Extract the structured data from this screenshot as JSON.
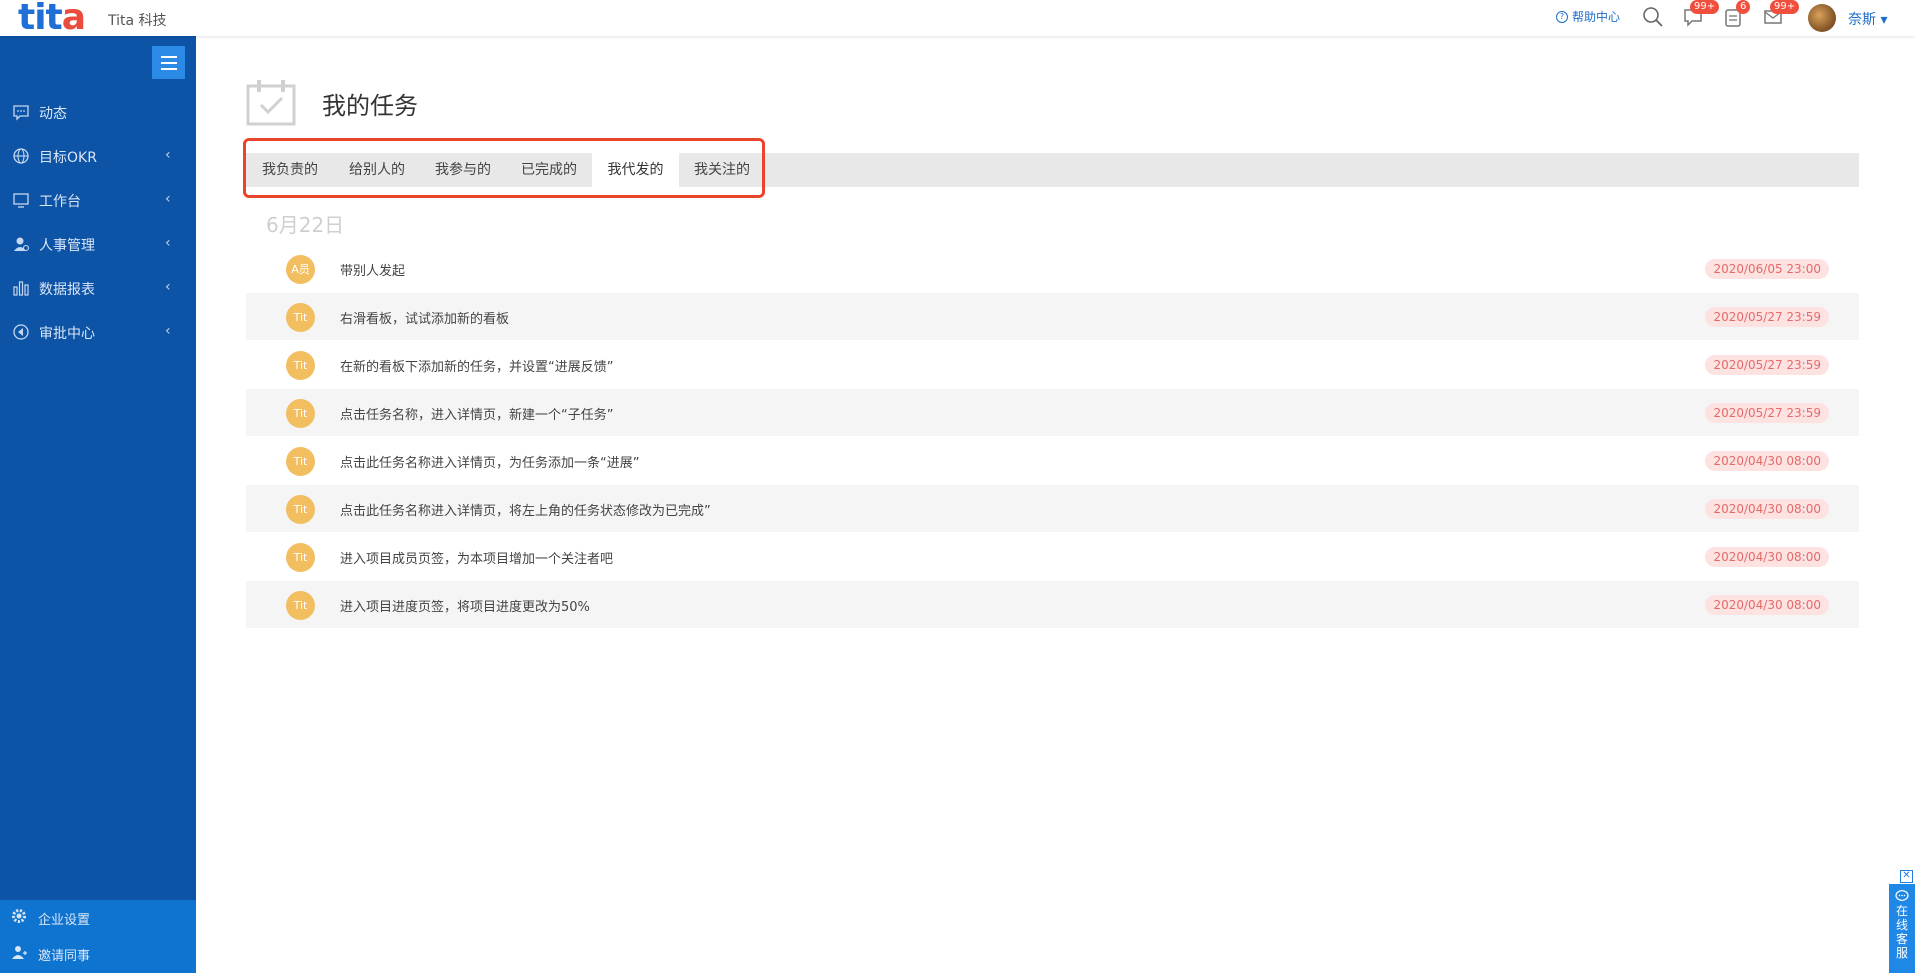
{
  "topbar": {
    "logo_part1": "tit",
    "logo_part2": "a",
    "company": "Tita 科技",
    "help_label": "帮助中心",
    "badges": {
      "messages": "99+",
      "tasks": "6",
      "mail": "99+"
    },
    "user_name": "奈斯 ▾"
  },
  "sidebar": {
    "items": [
      {
        "label": "动态",
        "icon": "comment-icon",
        "chevron": ""
      },
      {
        "label": "目标OKR",
        "icon": "globe-icon",
        "chevron": "‹"
      },
      {
        "label": "工作台",
        "icon": "monitor-icon",
        "chevron": "‹"
      },
      {
        "label": "人事管理",
        "icon": "person-icon",
        "chevron": "‹"
      },
      {
        "label": "数据报表",
        "icon": "bar-chart-icon",
        "chevron": "‹"
      },
      {
        "label": "审批中心",
        "icon": "approval-icon",
        "chevron": "‹"
      }
    ],
    "bottom": [
      {
        "label": "企业设置",
        "icon": "gear-icon"
      },
      {
        "label": "邀请同事",
        "icon": "add-user-icon"
      }
    ]
  },
  "main": {
    "title": "我的任务",
    "tabs": [
      "我负责的",
      "给别人的",
      "我参与的",
      "已完成的",
      "我代发的",
      "我关注的"
    ],
    "active_tab": "我代发的",
    "date_heading": "6月22日",
    "tasks": [
      {
        "avatar": "A员",
        "title": "带别人发起",
        "date": "2020/06/05 23:00"
      },
      {
        "avatar": "Tit",
        "title": "右滑看板，试试添加新的看板",
        "date": "2020/05/27 23:59"
      },
      {
        "avatar": "Tit",
        "title": "在新的看板下添加新的任务，并设置“进展反馈”",
        "date": "2020/05/27 23:59"
      },
      {
        "avatar": "Tit",
        "title": "点击任务名称，进入详情页，新建一个“子任务”",
        "date": "2020/05/27 23:59"
      },
      {
        "avatar": "Tit",
        "title": "点击此任务名称进入详情页，为任务添加一条“进展”",
        "date": "2020/04/30 08:00"
      },
      {
        "avatar": "Tit",
        "title": "点击此任务名称进入详情页，将左上角的任务状态修改为已完成”",
        "date": "2020/04/30 08:00"
      },
      {
        "avatar": "Tit",
        "title": "进入项目成员页签，为本项目增加一个关注者吧",
        "date": "2020/04/30 08:00"
      },
      {
        "avatar": "Tit",
        "title": "进入项目进度页签，将项目进度更改为50%",
        "date": "2020/04/30 08:00"
      }
    ]
  },
  "float_service": {
    "close": "✕",
    "text": [
      "在",
      "线",
      "客",
      "服"
    ]
  },
  "colors": {
    "sidebar": "#0d53a6",
    "accent": "#1e6ec8",
    "badge": "#f04f3d",
    "highlight": "#e8452a",
    "avatar": "#f2be60"
  }
}
